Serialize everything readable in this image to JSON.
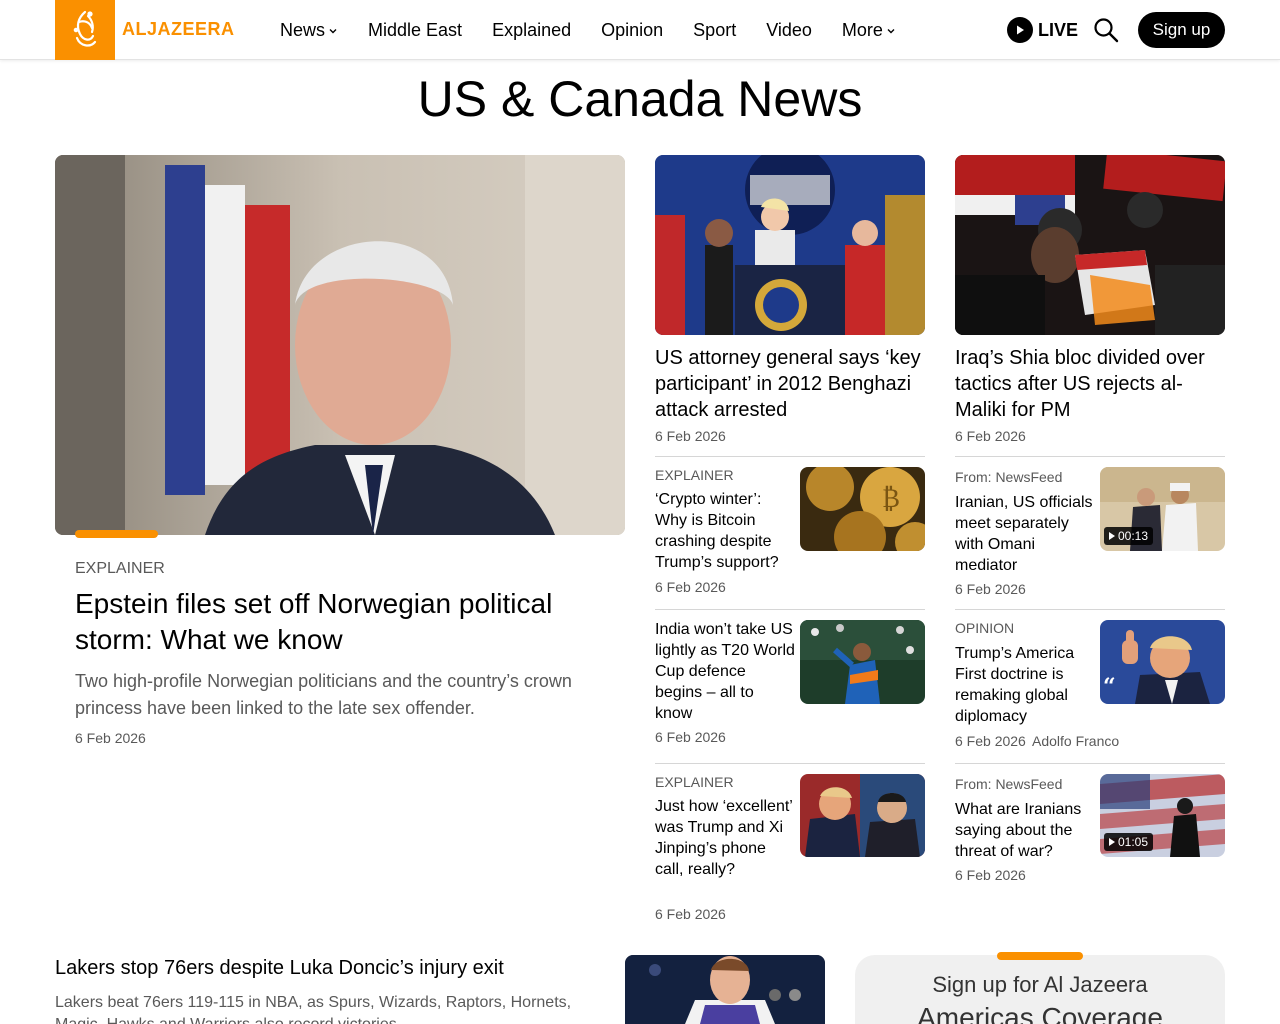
{
  "header": {
    "logo_text": "ALJAZEERA",
    "nav": [
      "News",
      "Middle East",
      "Explained",
      "Opinion",
      "Sport",
      "Video",
      "More"
    ],
    "live_label": "LIVE",
    "signup_label": "Sign up",
    "accent_color": "#fa9000"
  },
  "page_title": "US & Canada News",
  "feature": {
    "tag": "EXPLAINER",
    "title": "Epstein files set off Norwegian political storm: What we know",
    "description": "Two high-profile Norwegian politicians and the country’s crown princess have been linked to the late sex offender.",
    "date": "6 Feb 2026"
  },
  "col1_top": {
    "title": "US attorney general says ‘key participant’ in 2012 Benghazi attack arrested",
    "date": "6 Feb 2026"
  },
  "col2_top": {
    "title": "Iraq’s Shia bloc divided over tactics after US rejects al-Maliki for PM",
    "date": "6 Feb 2026"
  },
  "col1_items": [
    {
      "tag": "EXPLAINER",
      "title": "‘Crypto winter’: Why is Bitcoin crashing despite Trump’s support?",
      "date": "6 Feb 2026"
    },
    {
      "tag": "",
      "title": "India won’t take US lightly as T20 World Cup defence begins – all to know",
      "date": "6 Feb 2026"
    },
    {
      "tag": "EXPLAINER",
      "title": "Just how ‘excellent’ was Trump and Xi Jinping’s phone call, really?",
      "date": "6 Feb 2026"
    }
  ],
  "col2_items": [
    {
      "tag": "From: NewsFeed",
      "title": "Iranian, US officials meet separately with Omani mediator",
      "date": "6 Feb 2026",
      "duration": "00:13"
    },
    {
      "tag": "OPINION",
      "title": "Trump’s America First doctrine is remaking global diplomacy",
      "date": "6 Feb 2026",
      "author": "Adolfo Franco"
    },
    {
      "tag": "From: NewsFeed",
      "title": "What are Iranians saying about the threat of war?",
      "date": "6 Feb 2026",
      "duration": "01:05"
    }
  ],
  "bottom": {
    "title": "Lakers stop 76ers despite Luka Doncic’s injury exit",
    "description": "Lakers beat 76ers 119-115 in NBA, as Spurs, Wizards, Raptors, Hornets, Magic, Hawks and Warriors also record victories."
  },
  "newsletter": {
    "line1": "Sign up for Al Jazeera",
    "line2": "Americas Coverage"
  }
}
